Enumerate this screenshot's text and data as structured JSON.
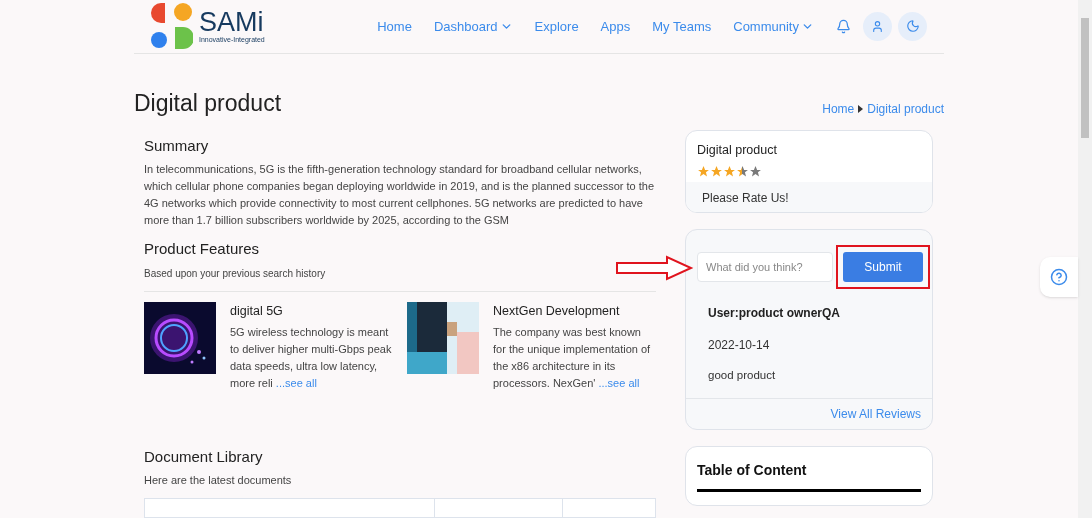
{
  "header": {
    "logo_text": "SAMi",
    "logo_tagline": "Innovative-Integrated",
    "nav": [
      {
        "label": "Home",
        "dropdown": false
      },
      {
        "label": "Dashboard",
        "dropdown": true
      },
      {
        "label": "Explore",
        "dropdown": false
      },
      {
        "label": "Apps",
        "dropdown": false
      },
      {
        "label": "My Teams",
        "dropdown": false
      },
      {
        "label": "Community",
        "dropdown": true
      }
    ]
  },
  "page_title": "Digital product",
  "breadcrumb": [
    "Home",
    "Digital product"
  ],
  "summary": {
    "heading": "Summary",
    "text": "In telecommunications, 5G is the fifth-generation technology standard for broadband cellular networks, which cellular phone companies began deploying worldwide in 2019, and is the planned successor to the 4G networks which provide connectivity to most current cellphones. 5G networks are predicted to have more than 1.7 billion subscribers worldwide by 2025, according to the GSM"
  },
  "features": {
    "heading": "Product Features",
    "subtitle": "Based upon your previous search history",
    "items": [
      {
        "title": "digital 5G",
        "text": "5G wireless technology is meant to deliver higher multi-Gbps peak data speeds, ultra low latency, more reli",
        "link": "...see all",
        "kind": "glow"
      },
      {
        "title": "NextGen Development",
        "text": "The company was best known for the unique implementation of the x86 architecture in its processors. NexGen'",
        "link": "...see all",
        "kind": "tech"
      }
    ]
  },
  "documents": {
    "heading": "Document Library",
    "subtitle": "Here are the latest documents"
  },
  "rating_card": {
    "title": "Digital product",
    "stars": 3.5,
    "prompt": "Please Rate Us!"
  },
  "review_card": {
    "placeholder": "What did you think?",
    "button": "Submit",
    "user": "User:product ownerQA",
    "date": "2022-10-14",
    "comment": "good product",
    "link": "View All Reviews"
  },
  "toc": {
    "title": "Table of Content"
  }
}
